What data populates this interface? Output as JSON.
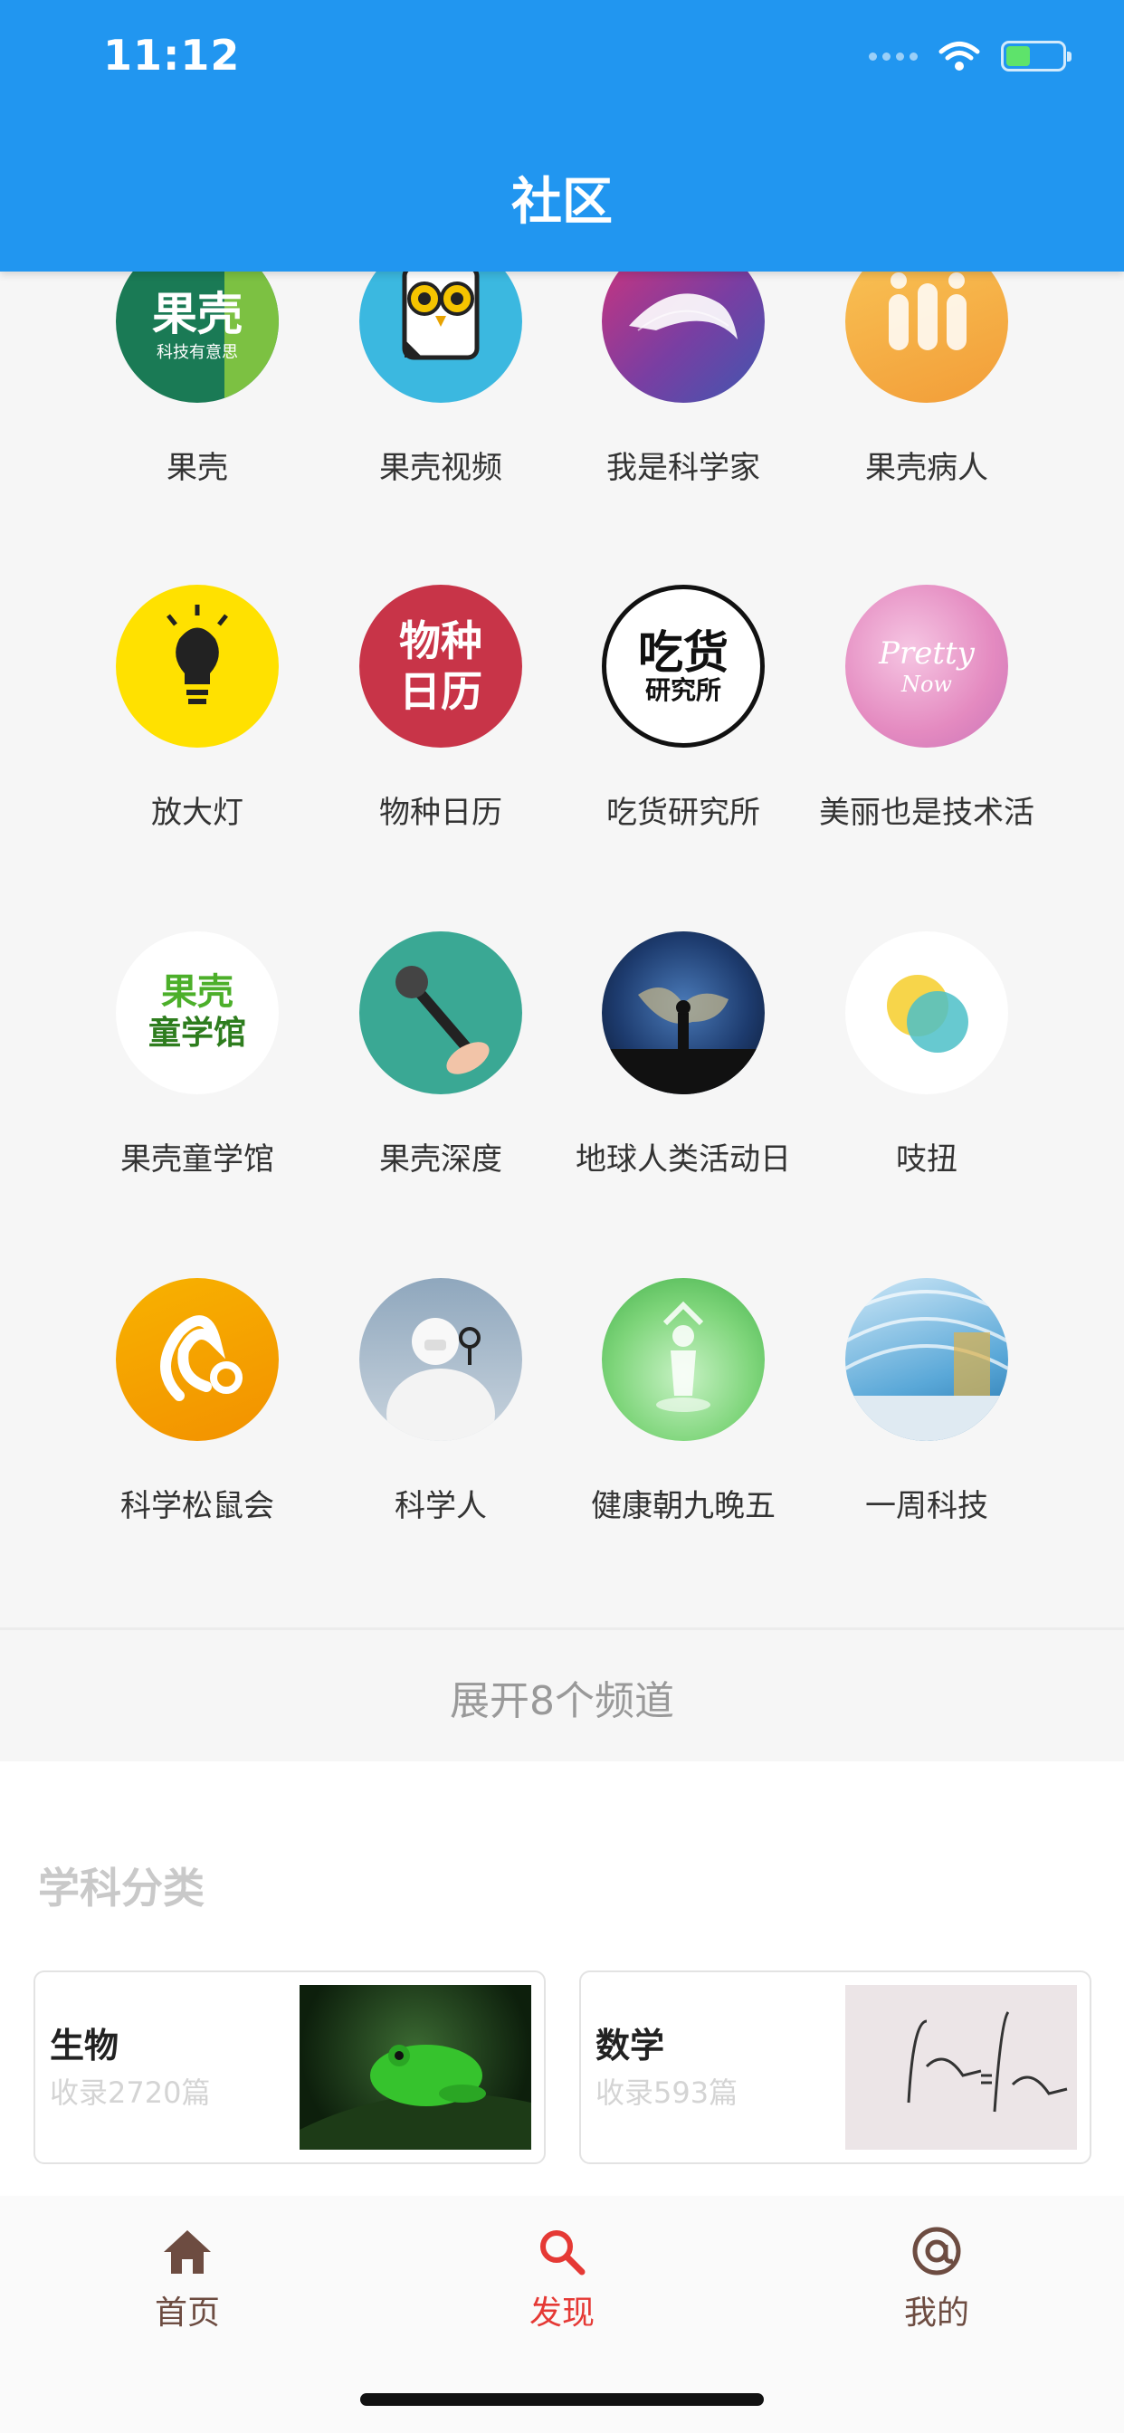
{
  "status_bar": {
    "time": "11:12"
  },
  "header": {
    "title": "社区"
  },
  "channels": [
    {
      "label": "果壳",
      "logo_text": "果壳",
      "logo_sub": "科技有意思"
    },
    {
      "label": "果壳视频"
    },
    {
      "label": "我是科学家"
    },
    {
      "label": "果壳病人"
    },
    {
      "label": "放大灯"
    },
    {
      "label": "物种日历",
      "logo_text": "物种",
      "logo_text2": "日历"
    },
    {
      "label": "吃货研究所",
      "logo_text": "吃货",
      "logo_sub": "研究所"
    },
    {
      "label": "美丽也是技术活",
      "logo_text": "Pretty",
      "logo_sub": "Now"
    },
    {
      "label": "果壳童学馆",
      "logo_text": "果壳",
      "logo_text2": "童学馆"
    },
    {
      "label": "果壳深度"
    },
    {
      "label": "地球人类活动日"
    },
    {
      "label": "吱扭"
    },
    {
      "label": "科学松鼠会"
    },
    {
      "label": "科学人"
    },
    {
      "label": "健康朝九晚五"
    },
    {
      "label": "一周科技"
    }
  ],
  "expand_label": "展开8个频道",
  "categories": {
    "title": "学科分类",
    "items": [
      {
        "name": "生物",
        "count": "收录2720篇"
      },
      {
        "name": "数学",
        "count": "收录593篇"
      }
    ]
  },
  "tabbar": {
    "items": [
      {
        "label": "首页",
        "icon": "home-icon",
        "color": "#6d4c41"
      },
      {
        "label": "发现",
        "icon": "search-icon",
        "color": "#e53935"
      },
      {
        "label": "我的",
        "icon": "at-icon",
        "color": "#6d4c41"
      }
    ]
  },
  "colors": {
    "accent": "#2196f0",
    "active_tab": "#e53935"
  }
}
